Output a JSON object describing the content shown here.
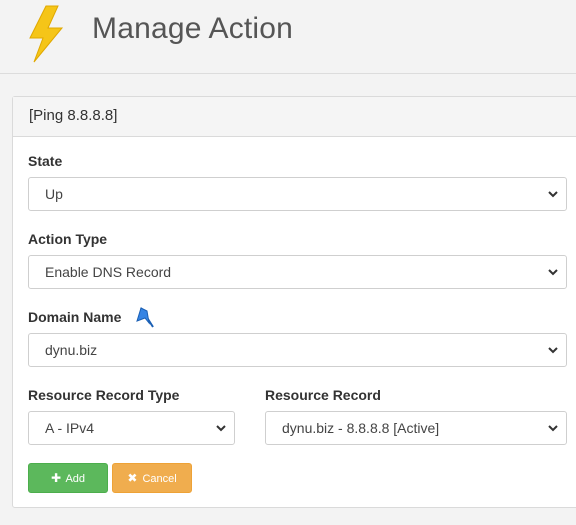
{
  "header": {
    "title": "Manage Action",
    "logo_icon": "lightning-bolt-icon"
  },
  "panel": {
    "heading": "[Ping 8.8.8.8]",
    "state": {
      "label": "State",
      "value": "Up"
    },
    "action_type": {
      "label": "Action Type",
      "value": "Enable DNS Record"
    },
    "domain_name": {
      "label": "Domain Name",
      "value": "dynu.biz",
      "icon": "flag-icon"
    },
    "resource_record_type": {
      "label": "Resource Record Type",
      "value": "A - IPv4"
    },
    "resource_record": {
      "label": "Resource Record",
      "value": "dynu.biz - 8.8.8.8 [Active]"
    },
    "buttons": {
      "add": "Add",
      "cancel": "Cancel"
    }
  },
  "colors": {
    "add_button": "#5cb85c",
    "cancel_button": "#f0ad4e",
    "bolt": "#f5c518"
  }
}
